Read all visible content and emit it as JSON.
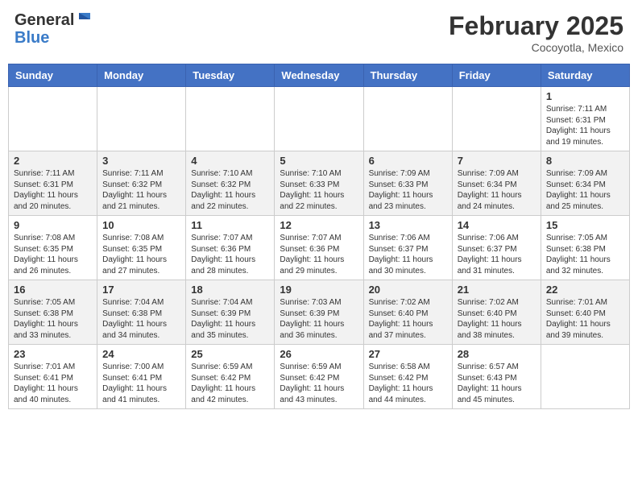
{
  "header": {
    "logo_general": "General",
    "logo_blue": "Blue",
    "month_title": "February 2025",
    "location": "Cocoyotla, Mexico"
  },
  "days_of_week": [
    "Sunday",
    "Monday",
    "Tuesday",
    "Wednesday",
    "Thursday",
    "Friday",
    "Saturday"
  ],
  "weeks": [
    [
      {
        "day": "",
        "info": ""
      },
      {
        "day": "",
        "info": ""
      },
      {
        "day": "",
        "info": ""
      },
      {
        "day": "",
        "info": ""
      },
      {
        "day": "",
        "info": ""
      },
      {
        "day": "",
        "info": ""
      },
      {
        "day": "1",
        "info": "Sunrise: 7:11 AM\nSunset: 6:31 PM\nDaylight: 11 hours and 19 minutes."
      }
    ],
    [
      {
        "day": "2",
        "info": "Sunrise: 7:11 AM\nSunset: 6:31 PM\nDaylight: 11 hours and 20 minutes."
      },
      {
        "day": "3",
        "info": "Sunrise: 7:11 AM\nSunset: 6:32 PM\nDaylight: 11 hours and 21 minutes."
      },
      {
        "day": "4",
        "info": "Sunrise: 7:10 AM\nSunset: 6:32 PM\nDaylight: 11 hours and 22 minutes."
      },
      {
        "day": "5",
        "info": "Sunrise: 7:10 AM\nSunset: 6:33 PM\nDaylight: 11 hours and 22 minutes."
      },
      {
        "day": "6",
        "info": "Sunrise: 7:09 AM\nSunset: 6:33 PM\nDaylight: 11 hours and 23 minutes."
      },
      {
        "day": "7",
        "info": "Sunrise: 7:09 AM\nSunset: 6:34 PM\nDaylight: 11 hours and 24 minutes."
      },
      {
        "day": "8",
        "info": "Sunrise: 7:09 AM\nSunset: 6:34 PM\nDaylight: 11 hours and 25 minutes."
      }
    ],
    [
      {
        "day": "9",
        "info": "Sunrise: 7:08 AM\nSunset: 6:35 PM\nDaylight: 11 hours and 26 minutes."
      },
      {
        "day": "10",
        "info": "Sunrise: 7:08 AM\nSunset: 6:35 PM\nDaylight: 11 hours and 27 minutes."
      },
      {
        "day": "11",
        "info": "Sunrise: 7:07 AM\nSunset: 6:36 PM\nDaylight: 11 hours and 28 minutes."
      },
      {
        "day": "12",
        "info": "Sunrise: 7:07 AM\nSunset: 6:36 PM\nDaylight: 11 hours and 29 minutes."
      },
      {
        "day": "13",
        "info": "Sunrise: 7:06 AM\nSunset: 6:37 PM\nDaylight: 11 hours and 30 minutes."
      },
      {
        "day": "14",
        "info": "Sunrise: 7:06 AM\nSunset: 6:37 PM\nDaylight: 11 hours and 31 minutes."
      },
      {
        "day": "15",
        "info": "Sunrise: 7:05 AM\nSunset: 6:38 PM\nDaylight: 11 hours and 32 minutes."
      }
    ],
    [
      {
        "day": "16",
        "info": "Sunrise: 7:05 AM\nSunset: 6:38 PM\nDaylight: 11 hours and 33 minutes."
      },
      {
        "day": "17",
        "info": "Sunrise: 7:04 AM\nSunset: 6:38 PM\nDaylight: 11 hours and 34 minutes."
      },
      {
        "day": "18",
        "info": "Sunrise: 7:04 AM\nSunset: 6:39 PM\nDaylight: 11 hours and 35 minutes."
      },
      {
        "day": "19",
        "info": "Sunrise: 7:03 AM\nSunset: 6:39 PM\nDaylight: 11 hours and 36 minutes."
      },
      {
        "day": "20",
        "info": "Sunrise: 7:02 AM\nSunset: 6:40 PM\nDaylight: 11 hours and 37 minutes."
      },
      {
        "day": "21",
        "info": "Sunrise: 7:02 AM\nSunset: 6:40 PM\nDaylight: 11 hours and 38 minutes."
      },
      {
        "day": "22",
        "info": "Sunrise: 7:01 AM\nSunset: 6:40 PM\nDaylight: 11 hours and 39 minutes."
      }
    ],
    [
      {
        "day": "23",
        "info": "Sunrise: 7:01 AM\nSunset: 6:41 PM\nDaylight: 11 hours and 40 minutes."
      },
      {
        "day": "24",
        "info": "Sunrise: 7:00 AM\nSunset: 6:41 PM\nDaylight: 11 hours and 41 minutes."
      },
      {
        "day": "25",
        "info": "Sunrise: 6:59 AM\nSunset: 6:42 PM\nDaylight: 11 hours and 42 minutes."
      },
      {
        "day": "26",
        "info": "Sunrise: 6:59 AM\nSunset: 6:42 PM\nDaylight: 11 hours and 43 minutes."
      },
      {
        "day": "27",
        "info": "Sunrise: 6:58 AM\nSunset: 6:42 PM\nDaylight: 11 hours and 44 minutes."
      },
      {
        "day": "28",
        "info": "Sunrise: 6:57 AM\nSunset: 6:43 PM\nDaylight: 11 hours and 45 minutes."
      },
      {
        "day": "",
        "info": ""
      }
    ]
  ]
}
